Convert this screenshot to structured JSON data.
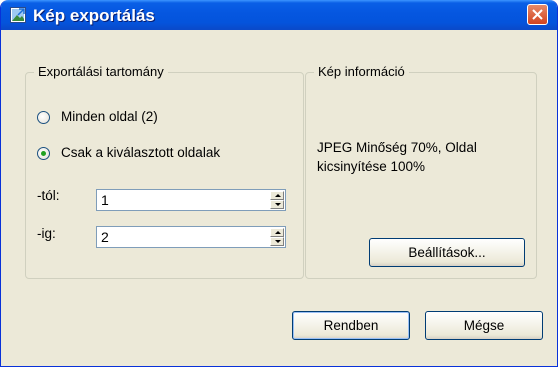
{
  "window": {
    "title": "Kép exportálás",
    "icon": "image-export-icon",
    "close_icon": "close-icon"
  },
  "range_group": {
    "legend": "Exportálási tartomány",
    "options": [
      {
        "label": "Minden oldal (2)",
        "checked": false
      },
      {
        "label": "Csak a kiválasztott oldalak",
        "checked": true
      }
    ],
    "from": {
      "label": "-tól:",
      "value": "1"
    },
    "to": {
      "label": "-ig:",
      "value": "2"
    }
  },
  "info_group": {
    "legend": "Kép információ",
    "text": "JPEG Minőség 70%, Oldal kicsinyítése 100%",
    "settings_button": "Beállítások..."
  },
  "footer": {
    "ok_button": "Rendben",
    "cancel_button": "Mégse"
  },
  "colors": {
    "titlebar": "#0556e0",
    "background": "#ece9d8",
    "close": "#d2431f",
    "radio_dot": "#21a121"
  }
}
